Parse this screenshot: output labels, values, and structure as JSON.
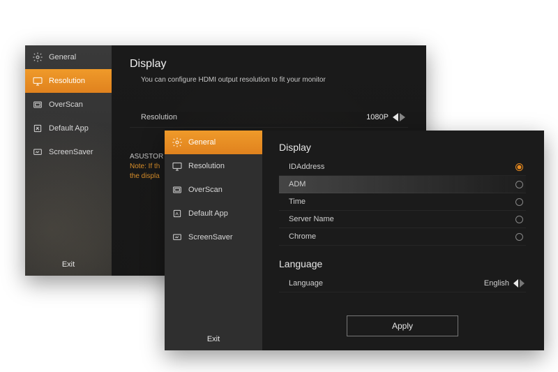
{
  "window1": {
    "sidebar": {
      "items": [
        {
          "label": "General"
        },
        {
          "label": "Resolution"
        },
        {
          "label": "OverScan"
        },
        {
          "label": "Default App"
        },
        {
          "label": "ScreenSaver"
        }
      ],
      "exit_label": "Exit"
    },
    "main": {
      "title": "Display",
      "desc": "You can configure  HDMI output resolution to  fit your monitor",
      "resolution_label": "Resolution",
      "resolution_value": "1080P",
      "note_line1": "ASUSTOR Portal inte",
      "note_line2a": "Note: If th",
      "note_line2b": "the displa"
    }
  },
  "window2": {
    "sidebar": {
      "items": [
        {
          "label": "General"
        },
        {
          "label": "Resolution"
        },
        {
          "label": "OverScan"
        },
        {
          "label": "Default App"
        },
        {
          "label": "ScreenSaver"
        }
      ],
      "exit_label": "Exit"
    },
    "main": {
      "display_title": "Display",
      "display_options": [
        {
          "label": "IDAddress",
          "selected": true
        },
        {
          "label": "ADM",
          "selected": false,
          "highlight": true
        },
        {
          "label": "Time",
          "selected": false
        },
        {
          "label": "Server Name",
          "selected": false
        },
        {
          "label": "Chrome",
          "selected": false
        }
      ],
      "language_title": "Language",
      "language_label": "Language",
      "language_value": "English",
      "apply_label": "Apply"
    }
  },
  "colors": {
    "accent": "#e88a1f"
  }
}
